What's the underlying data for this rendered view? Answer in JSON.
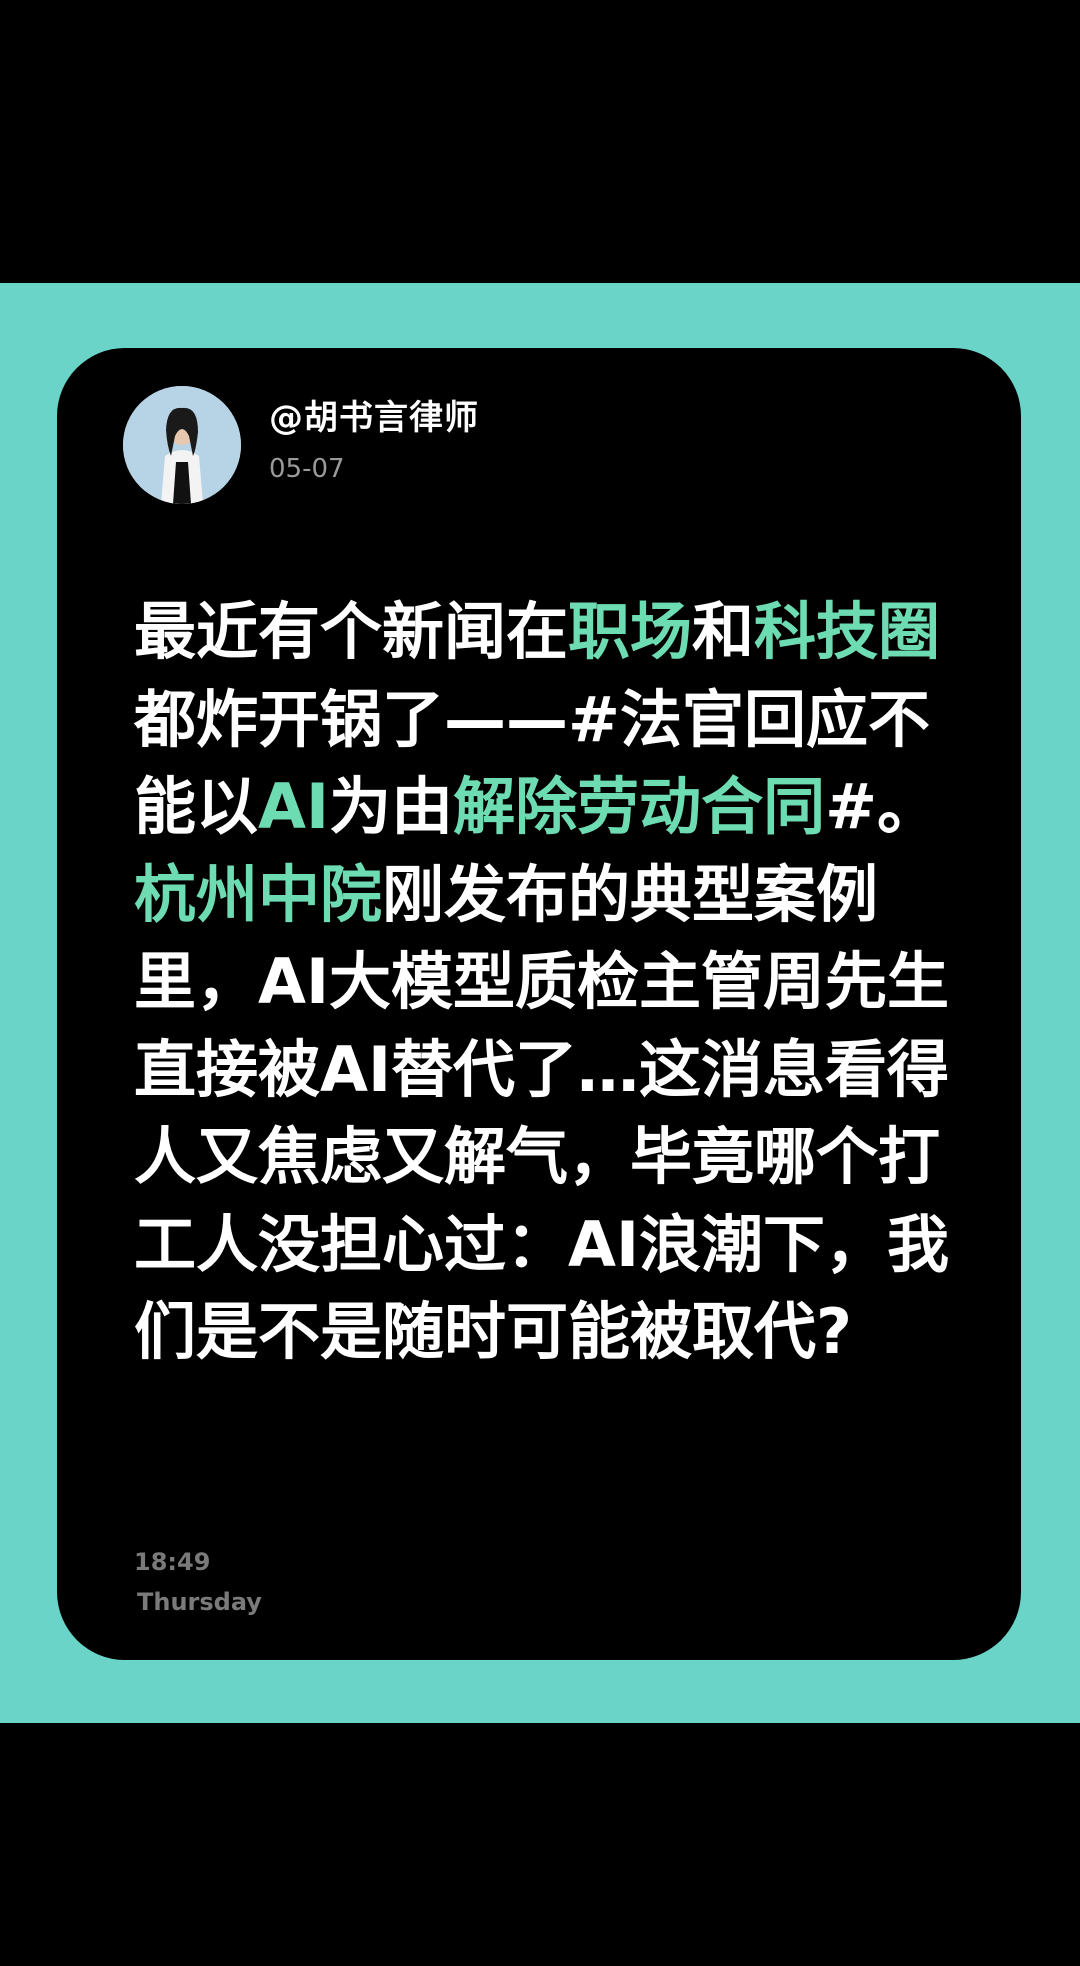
{
  "post": {
    "author": "@胡书言律师",
    "date": "05-07",
    "body_segments": [
      {
        "text": "最近有个新闻在",
        "highlight": false
      },
      {
        "text": "职场",
        "highlight": true
      },
      {
        "text": "和",
        "highlight": false
      },
      {
        "text": "科技圈",
        "highlight": true
      },
      {
        "text": "都炸开锅了——#法官回应不能以",
        "highlight": false
      },
      {
        "text": "AI",
        "highlight": true
      },
      {
        "text": "为由",
        "highlight": false
      },
      {
        "text": "解除劳动合同",
        "highlight": true
      },
      {
        "text": "#。",
        "highlight": false
      },
      {
        "text": "杭州中院",
        "highlight": true
      },
      {
        "text": "刚发布的典型案例里，AI大模型质检主管周先生直接被AI替代了…这消息看得人又焦虑又解气，毕竟哪个打工人没担心过：AI浪潮下，我们是不是随时可能被取代?",
        "highlight": false
      }
    ],
    "time": "18:49",
    "weekday": "Thursday"
  },
  "colors": {
    "page_background": "#000000",
    "frame_band": "#6ad4c9",
    "card_background": "#000000",
    "highlight_text": "#6edcb3",
    "body_text": "#ffffff",
    "meta_text": "#7a7a7a"
  },
  "icons": {
    "avatar": "profile-photo"
  }
}
